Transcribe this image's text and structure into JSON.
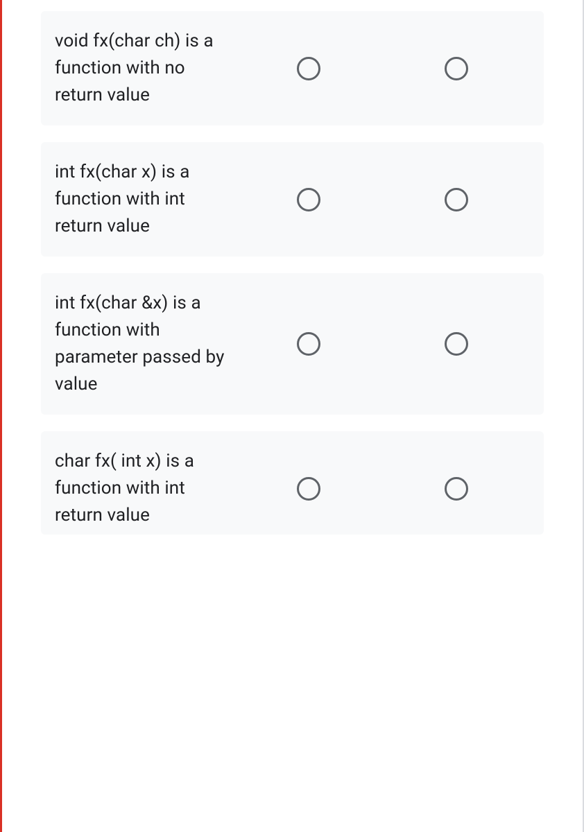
{
  "questions": [
    {
      "text": "void fx(char ch) is a function with no return value"
    },
    {
      "text": "int fx(char x) is a function with int return value"
    },
    {
      "text": "int fx(char &x) is a function with parameter passed by value"
    },
    {
      "text": "char fx( int x) is a function with int return value"
    }
  ]
}
